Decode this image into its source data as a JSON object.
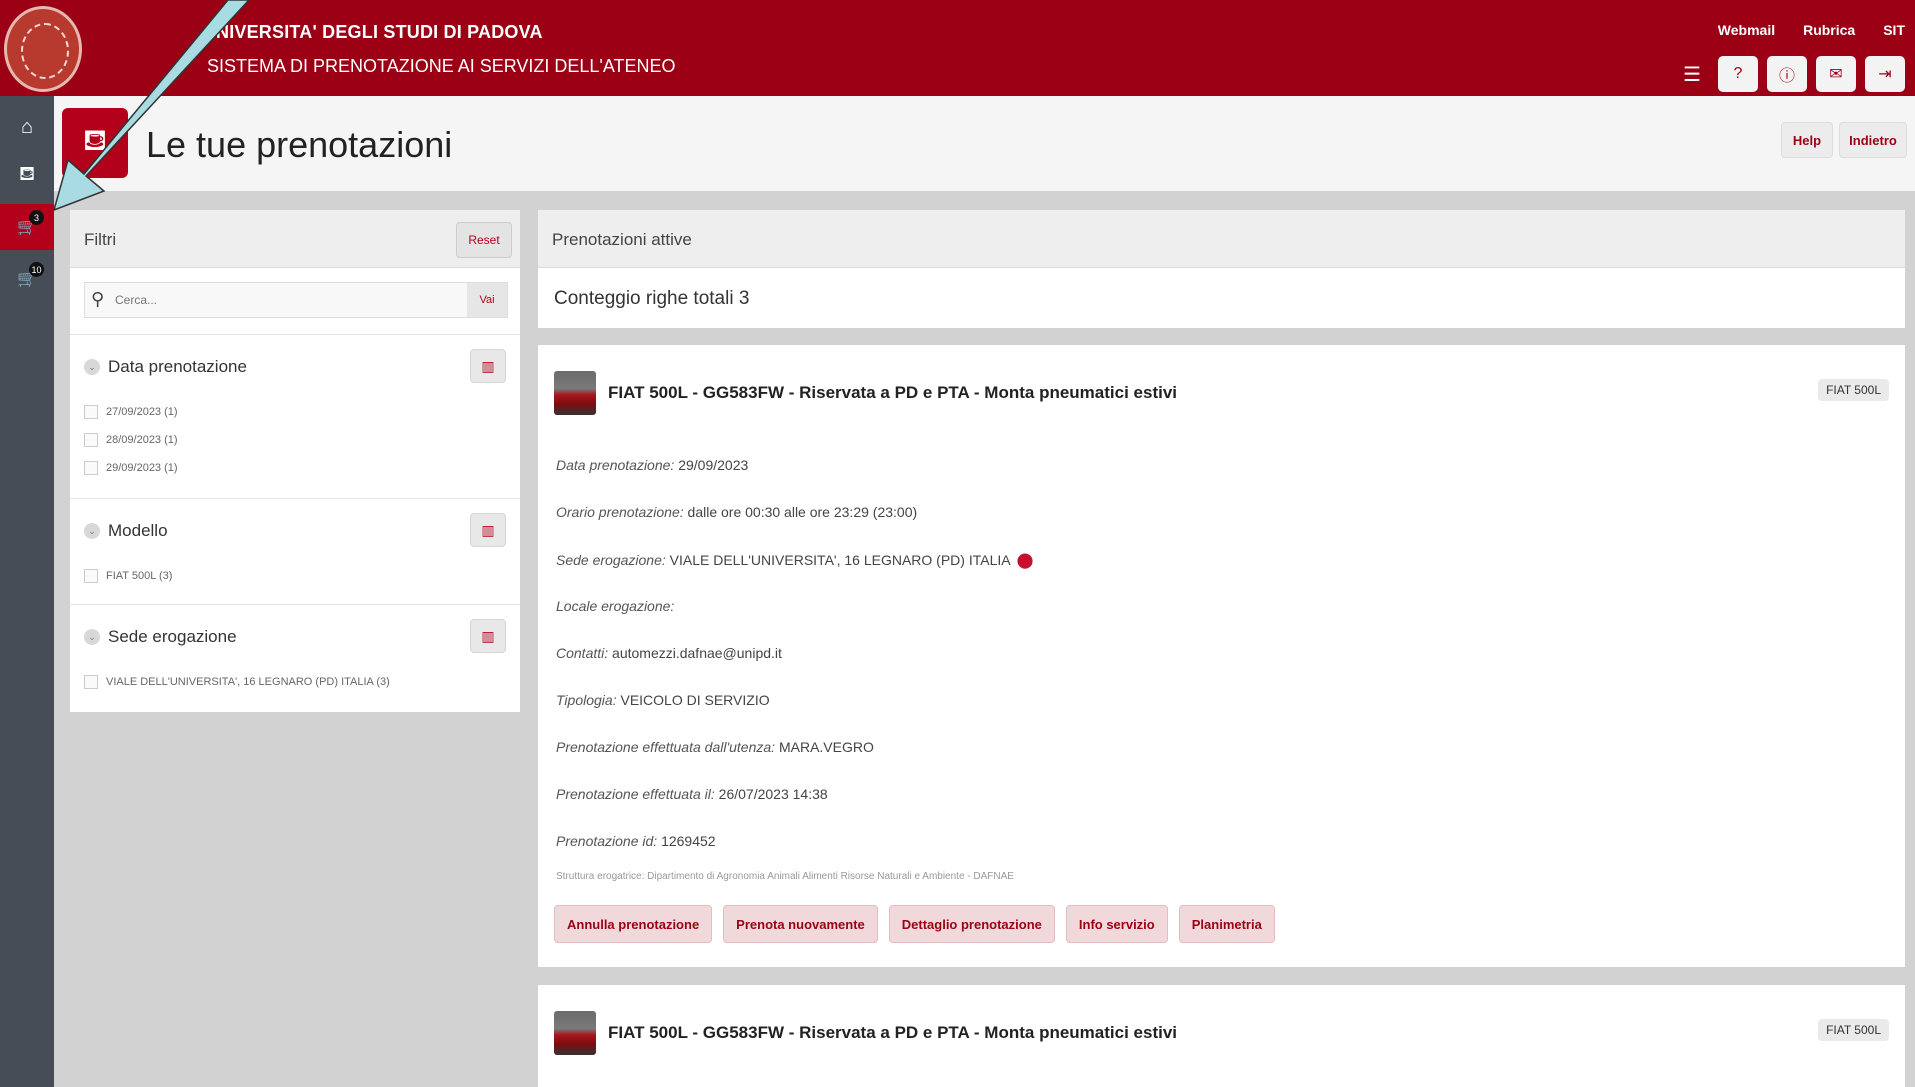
{
  "header": {
    "university": "NIVERSITA' DEGLI STUDI DI PADOVA",
    "system": "SISTEMA DI PRENOTAZIONE AI SERVIZI DELL'ATENEO",
    "links": [
      "Webmail",
      "Rubrica",
      "SIT"
    ],
    "icons": [
      "menu-icon",
      "help-circle-icon",
      "info-circle-icon",
      "mail-icon",
      "logout-icon"
    ]
  },
  "sidebar": {
    "items": [
      {
        "icon": "home-icon",
        "glyph": "⌂"
      },
      {
        "icon": "basket-icon",
        "glyph": "⛾"
      },
      {
        "icon": "cart-badge-icon",
        "glyph": "🛒",
        "badge": "3",
        "active": true
      },
      {
        "icon": "cart-badge-icon",
        "glyph": "🛒",
        "badge": "10"
      }
    ]
  },
  "title_bar": {
    "title": "Le tue prenotazioni",
    "help_label": "Help",
    "back_label": "Indietro"
  },
  "filters": {
    "heading": "Filtri",
    "reset_label": "Reset",
    "search_placeholder": "Cerca...",
    "search_button": "Vai",
    "sections": [
      {
        "title": "Data prenotazione",
        "options": [
          "27/09/2023 (1)",
          "28/09/2023 (1)",
          "29/09/2023 (1)"
        ]
      },
      {
        "title": "Modello",
        "options": [
          "FIAT 500L (3)"
        ]
      },
      {
        "title": "Sede erogazione",
        "options": [
          "VIALE DELL'UNIVERSITA', 16 LEGNARO (PD) ITALIA (3)"
        ]
      }
    ]
  },
  "main": {
    "heading": "Prenotazioni attive",
    "count": "Conteggio righe totali 3",
    "bookings": [
      {
        "title": "FIAT 500L - GG583FW - Riservata a PD e PTA - Monta pneumatici estivi",
        "badge": "FIAT 500L",
        "fields": [
          {
            "label": "Data prenotazione:",
            "value": "29/09/2023"
          },
          {
            "label": "Orario prenotazione:",
            "value": "dalle ore 00:30 alle ore 23:29 (23:00)"
          },
          {
            "label": "Sede erogazione:",
            "value": "VIALE DELL'UNIVERSITA', 16 LEGNARO (PD) ITALIA"
          },
          {
            "label": "Locale erogazione:",
            "value": ""
          },
          {
            "label": "Contatti:",
            "value": "automezzi.dafnae@unipd.it"
          },
          {
            "label": "Tipologia:",
            "value": "VEICOLO DI SERVIZIO"
          },
          {
            "label": "Prenotazione effettuata dall'utenza:",
            "value": "MARA.VEGRO"
          },
          {
            "label": "Prenotazione effettuata il:",
            "value": "26/07/2023 14:38"
          },
          {
            "label": "Prenotazione id:",
            "value": "1269452"
          }
        ],
        "struttura": "Struttura erogatrice: Dipartimento di Agronomia Animali Alimenti Risorse Naturali e Ambiente - DAFNAE",
        "actions": [
          "Annulla prenotazione",
          "Prenota nuovamente",
          "Dettaglio prenotazione",
          "Info servizio",
          "Planimetria"
        ]
      },
      {
        "title": "FIAT 500L - GG583FW - Riservata a PD e PTA - Monta pneumatici estivi",
        "badge": "FIAT 500L"
      }
    ]
  },
  "colors": {
    "brand": "#9b0014",
    "sidebar": "#464d57",
    "active": "#b3001b",
    "annotation_arrow": "#a8dbe2"
  }
}
